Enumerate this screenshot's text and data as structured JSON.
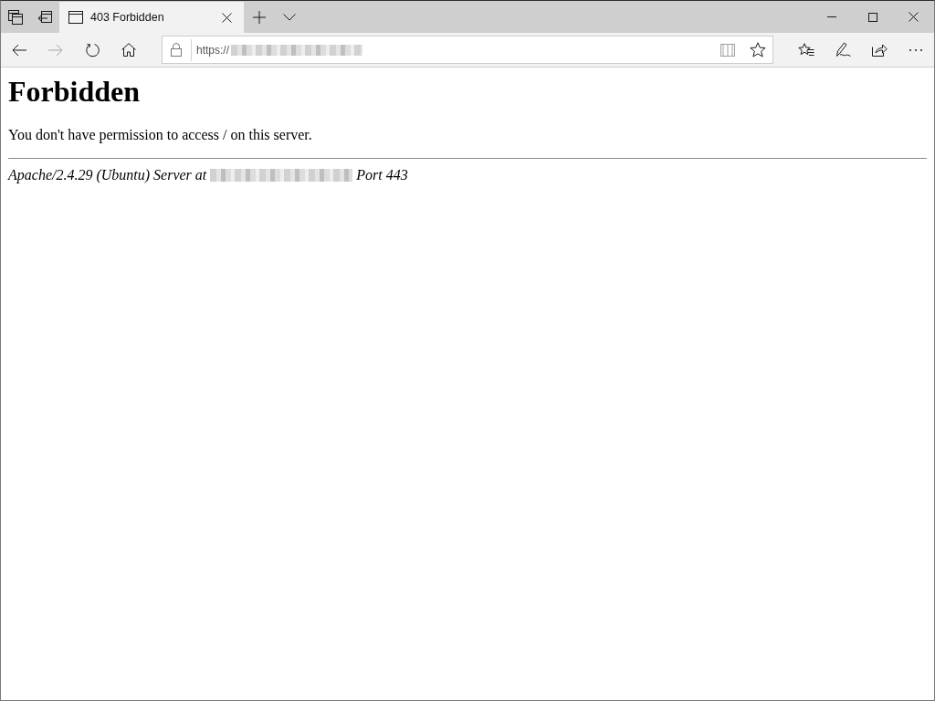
{
  "tabs": [
    {
      "title": "403 Forbidden",
      "selected": true
    }
  ],
  "nav_buttons": [
    {
      "kind": "back",
      "disabled": false
    },
    {
      "kind": "forward",
      "disabled": true
    },
    {
      "kind": "refresh",
      "disabled": false
    },
    {
      "kind": "home",
      "disabled": false
    }
  ],
  "address_bar": {
    "value": "https://",
    "host_redacted": true,
    "actions": [
      {
        "kind": "reading_view",
        "disabled": true
      },
      {
        "kind": "favorite",
        "disabled": false
      }
    ]
  },
  "toolbar_buttons": [
    {
      "kind": "favorites"
    },
    {
      "kind": "notes"
    },
    {
      "kind": "share"
    },
    {
      "kind": "more"
    }
  ],
  "page": {
    "heading": "Forbidden",
    "message": "You don't have permission to access / on this server.",
    "signature": {
      "start": "Apache/2.4.29 (Ubuntu) Server at",
      "host_redacted": true,
      "end": "Port 443"
    }
  }
}
